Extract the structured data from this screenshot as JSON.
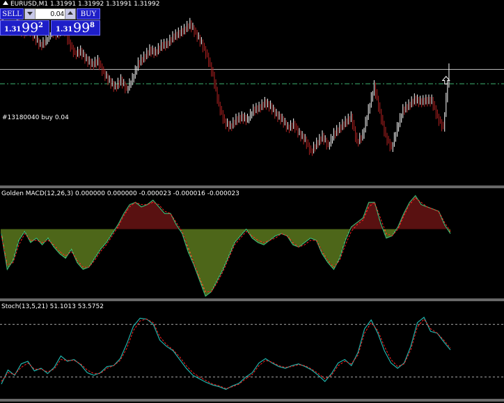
{
  "header": {
    "symbol_line": "EURUSD,M1  1.31991 1.31992 1.31991 1.31992"
  },
  "trade_panel": {
    "sell_label": "SELL",
    "buy_label": "BUY",
    "lot_value": "0.04",
    "sell_price": {
      "big": "1.31",
      "mid": "99",
      "pip": "2"
    },
    "buy_price": {
      "big": "1.31",
      "mid": "99",
      "pip": "8"
    }
  },
  "order_line": {
    "label": "#13180040 buy 0.04",
    "price_level": 1.3198
  },
  "colors": {
    "background": "#000000",
    "bull_candle": "#ffffff",
    "bear_candle": "#b22222",
    "order_line": "#3cb371",
    "macd_positive": "#b22222",
    "macd_negative": "#9acd32",
    "macd_signal": "#ff2020",
    "stoch_main": "#20b2aa",
    "stoch_signal": "#ff2020",
    "panel_button": "#1e1ec8"
  },
  "chart_data": [
    {
      "type": "candlestick",
      "title": "EURUSD,M1",
      "ylim": [
        1.31895,
        1.3205
      ],
      "bid_level": 1.31992,
      "close": [
        1.32028,
        1.32024,
        1.32031,
        1.32022,
        1.32026,
        1.32019,
        1.32012,
        1.32016,
        1.32024,
        1.32021,
        1.32028,
        1.32014,
        1.32005,
        1.32007,
        1.32,
        1.31996,
        1.31999,
        1.31989,
        1.31982,
        1.31977,
        1.31983,
        1.31975,
        1.31984,
        1.31997,
        1.32002,
        1.32008,
        1.32006,
        1.32012,
        1.32013,
        1.32019,
        1.32022,
        1.32025,
        1.3203,
        1.32022,
        1.32014,
        1.32003,
        1.31987,
        1.31962,
        1.31948,
        1.31944,
        1.3195,
        1.31952,
        1.3195,
        1.31958,
        1.3196,
        1.31964,
        1.31961,
        1.31954,
        1.3195,
        1.31943,
        1.31946,
        1.31938,
        1.31933,
        1.31923,
        1.3193,
        1.31936,
        1.31928,
        1.31938,
        1.31943,
        1.31948,
        1.31952,
        1.31931,
        1.31937,
        1.31958,
        1.31978,
        1.31956,
        1.31936,
        1.31926,
        1.31943,
        1.31958,
        1.31962,
        1.31967,
        1.31965,
        1.31966,
        1.31966,
        1.31952,
        1.31943,
        1.31992
      ]
    },
    {
      "type": "histogram+line",
      "title": "Golden MACD(12,26,3) 0.000000 0.000000 -0.000023 -0.000016 -0.000023",
      "ylim": [
        -0.00031,
        0.00018
      ],
      "histogram": [
        -2e-05,
        -0.00018,
        -0.00014,
        -5e-05,
        -1e-05,
        -6e-05,
        -4e-05,
        -7e-05,
        -4e-05,
        -8e-05,
        -0.00011,
        -0.00013,
        -9e-05,
        -0.00015,
        -0.00018,
        -0.00017,
        -0.00013,
        -9e-05,
        -6e-05,
        -2e-05,
        2e-05,
        7e-05,
        0.00011,
        0.00012,
        0.0001,
        0.00011,
        0.00013,
        0.0001,
        7e-05,
        7e-05,
        2e-05,
        -2e-05,
        -0.0001,
        -0.00016,
        -0.00023,
        -0.0003,
        -0.00028,
        -0.00023,
        -0.00018,
        -0.00012,
        -6e-05,
        -3e-05,
        0.0,
        -4e-05,
        -6e-05,
        -7e-05,
        -5e-05,
        -3e-05,
        -2e-05,
        -3e-05,
        -7e-05,
        -8e-05,
        -6e-05,
        -4e-05,
        -5e-05,
        -0.00011,
        -0.00015,
        -0.00018,
        -0.00013,
        -5e-05,
        1e-05,
        3e-05,
        5e-05,
        0.00012,
        0.00012,
        3e-05,
        -4e-05,
        -3e-05,
        1e-05,
        7e-05,
        0.00012,
        0.00015,
        0.00011,
        0.0001,
        9e-05,
        8e-05,
        2e-05,
        -2e-05
      ],
      "signal": [
        -3e-05,
        -0.00016,
        -0.00015,
        -7e-05,
        -2e-05,
        -5e-05,
        -5e-05,
        -6e-05,
        -5e-05,
        -7e-05,
        -0.0001,
        -0.00012,
        -0.0001,
        -0.00014,
        -0.00017,
        -0.00017,
        -0.00014,
        -0.0001,
        -7e-05,
        -3e-05,
        1e-05,
        6e-05,
        0.0001,
        0.00012,
        0.00011,
        0.00011,
        0.00012,
        0.00011,
        8e-05,
        7e-05,
        3e-05,
        -1e-05,
        -8e-05,
        -0.00015,
        -0.00022,
        -0.00028,
        -0.00028,
        -0.00024,
        -0.00019,
        -0.00013,
        -7e-05,
        -4e-05,
        -1e-05,
        -3e-05,
        -5e-05,
        -6e-05,
        -5e-05,
        -4e-05,
        -2e-05,
        -3e-05,
        -6e-05,
        -8e-05,
        -7e-05,
        -5e-05,
        -5e-05,
        -0.0001,
        -0.00014,
        -0.00017,
        -0.00014,
        -7e-05,
        -1e-05,
        2e-05,
        4e-05,
        0.0001,
        0.00012,
        5e-05,
        -2e-05,
        -3e-05,
        0.0,
        6e-05,
        0.00011,
        0.00014,
        0.00012,
        0.0001,
        9e-05,
        8e-05,
        3e-05,
        -1e-05
      ]
    },
    {
      "type": "line",
      "title": "Stoch(13,5,21) 51.1013 53.5752",
      "ylim": [
        0,
        100
      ],
      "levels": [
        80,
        20
      ],
      "main": [
        12,
        28,
        22,
        35,
        38,
        27,
        30,
        24,
        31,
        44,
        38,
        40,
        34,
        25,
        22,
        25,
        32,
        33,
        41,
        58,
        78,
        87,
        86,
        80,
        62,
        55,
        50,
        40,
        30,
        22,
        18,
        14,
        11,
        9,
        6,
        10,
        13,
        20,
        25,
        36,
        41,
        36,
        32,
        30,
        33,
        35,
        32,
        28,
        22,
        15,
        24,
        36,
        40,
        33,
        48,
        75,
        85,
        70,
        50,
        36,
        30,
        36,
        55,
        82,
        88,
        72,
        70,
        60,
        51
      ],
      "signal": [
        15,
        25,
        23,
        31,
        36,
        29,
        29,
        26,
        29,
        40,
        39,
        39,
        35,
        28,
        24,
        24,
        30,
        33,
        39,
        53,
        73,
        84,
        86,
        82,
        66,
        57,
        51,
        43,
        33,
        25,
        20,
        16,
        12,
        10,
        7,
        9,
        12,
        18,
        23,
        33,
        39,
        37,
        33,
        31,
        32,
        34,
        33,
        29,
        24,
        18,
        22,
        33,
        38,
        35,
        45,
        70,
        82,
        73,
        55,
        40,
        32,
        35,
        51,
        77,
        86,
        75,
        70,
        62,
        53
      ]
    }
  ]
}
